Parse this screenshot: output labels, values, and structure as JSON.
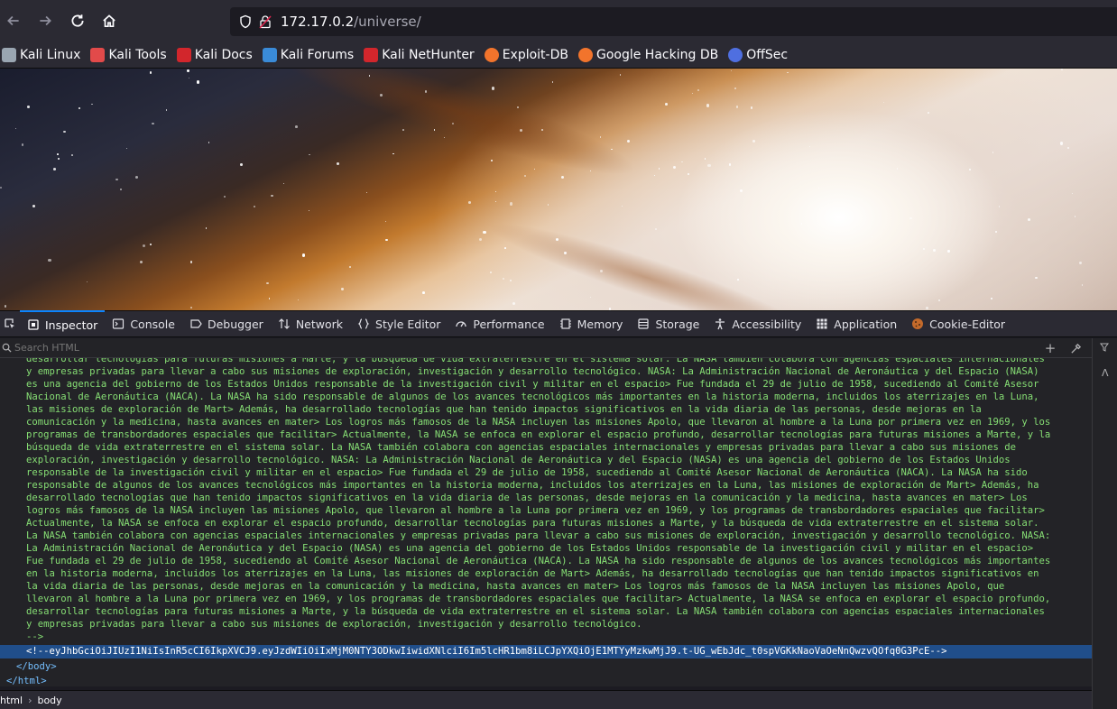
{
  "browser": {
    "url_host": "172.17.0.2",
    "url_path": "/universe/"
  },
  "bookmarks": [
    {
      "label": "Kali Linux",
      "icon": "kali-dragon-icon",
      "color": "#9aa6b2"
    },
    {
      "label": "Kali Tools",
      "icon": "kali-tools-icon",
      "color": "#e24a4a"
    },
    {
      "label": "Kali Docs",
      "icon": "kali-docs-icon",
      "color": "#d2262c"
    },
    {
      "label": "Kali Forums",
      "icon": "kali-forums-icon",
      "color": "#3a8bd8"
    },
    {
      "label": "Kali NetHunter",
      "icon": "nethunter-icon",
      "color": "#d2262c"
    },
    {
      "label": "Exploit-DB",
      "icon": "exploit-db-icon",
      "color": "#f2742c"
    },
    {
      "label": "Google Hacking DB",
      "icon": "ghdb-icon",
      "color": "#f2742c"
    },
    {
      "label": "OffSec",
      "icon": "offsec-icon",
      "color": "#4f6fe0"
    }
  ],
  "devtools": {
    "tabs": [
      {
        "label": "Inspector",
        "icon": "inspector-icon",
        "active": true
      },
      {
        "label": "Console",
        "icon": "console-icon"
      },
      {
        "label": "Debugger",
        "icon": "debugger-icon"
      },
      {
        "label": "Network",
        "icon": "network-icon"
      },
      {
        "label": "Style Editor",
        "icon": "style-editor-icon"
      },
      {
        "label": "Performance",
        "icon": "performance-icon"
      },
      {
        "label": "Memory",
        "icon": "memory-icon"
      },
      {
        "label": "Storage",
        "icon": "storage-icon"
      },
      {
        "label": "Accessibility",
        "icon": "accessibility-icon"
      },
      {
        "label": "Application",
        "icon": "application-icon"
      },
      {
        "label": "Cookie-Editor",
        "icon": "cookie-icon"
      }
    ],
    "search_placeholder": "Search HTML",
    "comment_lines": [
      "desarrollar tecnologías para futuras misiones a Marte, y la búsqueda de vida extraterrestre en el sistema solar. La NASA también colabora con agencias espaciales internacionales",
      "y empresas privadas para llevar a cabo sus misiones de exploración, investigación y desarrollo tecnológico. NASA: La Administración Nacional de Aeronáutica y del Espacio (NASA)",
      "es una agencia del gobierno de los Estados Unidos responsable de la investigación civil y militar en el espacio> Fue fundada el 29 de julio de 1958, sucediendo al Comité Asesor",
      "Nacional de Aeronáutica (NACA). La NASA ha sido responsable de algunos de los avances tecnológicos más importantes en la historia moderna, incluidos los aterrizajes en la Luna,",
      "las misiones de exploración de Mart> Además, ha desarrollado tecnologías que han tenido impactos significativos en la vida diaria de las personas, desde mejoras en la",
      "comunicación y la medicina, hasta avances en mater> Los logros más famosos de la NASA incluyen las misiones Apolo, que llevaron al hombre a la Luna por primera vez en 1969, y los",
      "programas de transbordadores espaciales que facilitar> Actualmente, la NASA se enfoca en explorar el espacio profundo, desarrollar tecnologías para futuras misiones a Marte, y la",
      "búsqueda de vida extraterrestre en el sistema solar. La NASA también colabora con agencias espaciales internacionales y empresas privadas para llevar a cabo sus misiones de",
      "exploración, investigación y desarrollo tecnológico. NASA: La Administración Nacional de Aeronáutica y del Espacio (NASA) es una agencia del gobierno de los Estados Unidos",
      "responsable de la investigación civil y militar en el espacio> Fue fundada el 29 de julio de 1958, sucediendo al Comité Asesor Nacional de Aeronáutica (NACA). La NASA ha sido",
      "responsable de algunos de los avances tecnológicos más importantes en la historia moderna, incluidos los aterrizajes en la Luna, las misiones de exploración de Mart> Además, ha",
      "desarrollado tecnologías que han tenido impactos significativos en la vida diaria de las personas, desde mejoras en la comunicación y la medicina, hasta avances en mater> Los",
      "logros más famosos de la NASA incluyen las misiones Apolo, que llevaron al hombre a la Luna por primera vez en 1969, y los programas de transbordadores espaciales que facilitar>",
      "Actualmente, la NASA se enfoca en explorar el espacio profundo, desarrollar tecnologías para futuras misiones a Marte, y la búsqueda de vida extraterrestre en el sistema solar.",
      "La NASA también colabora con agencias espaciales internacionales y empresas privadas para llevar a cabo sus misiones de exploración, investigación y desarrollo tecnológico. NASA:",
      "La Administración Nacional de Aeronáutica y del Espacio (NASA) es una agencia del gobierno de los Estados Unidos responsable de la investigación civil y militar en el espacio>",
      "Fue fundada el 29 de julio de 1958, sucediendo al Comité Asesor Nacional de Aeronáutica (NACA). La NASA ha sido responsable de algunos de los avances tecnológicos más importantes",
      "en la historia moderna, incluidos los aterrizajes en la Luna, las misiones de exploración de Mart> Además, ha desarrollado tecnologías que han tenido impactos significativos en",
      "la vida diaria de las personas, desde mejoras en la comunicación y la medicina, hasta avances en mater> Los logros más famosos de la NASA incluyen las misiones Apolo, que",
      "llevaron al hombre a la Luna por primera vez en 1969, y los programas de transbordadores espaciales que facilitar> Actualmente, la NASA se enfoca en explorar el espacio profundo,",
      "desarrollar tecnologías para futuras misiones a Marte, y la búsqueda de vida extraterrestre en el sistema solar. La NASA también colabora con agencias espaciales internacionales",
      "y empresas privadas para llevar a cabo sus misiones de exploración, investigación y desarrollo tecnológico."
    ],
    "comment_close": "-->",
    "jwt_comment": "<!--eyJhbGciOiJIUzI1NiIsInR5cCI6IkpXVCJ9.eyJzdWIiOiIxMjM0NTY3ODkwIiwidXNlciI6Im5lcHR1bm8iLCJpYXQiOjE1MTYyMzkwMjJ9.t-UG_wEbJdc_t0spVGKkNaoVaOeNnQwzvQOfq0G3PcE-->",
    "close_body": "</body>",
    "close_html": "</html>",
    "breadcrumbs": [
      "html",
      "body"
    ]
  }
}
